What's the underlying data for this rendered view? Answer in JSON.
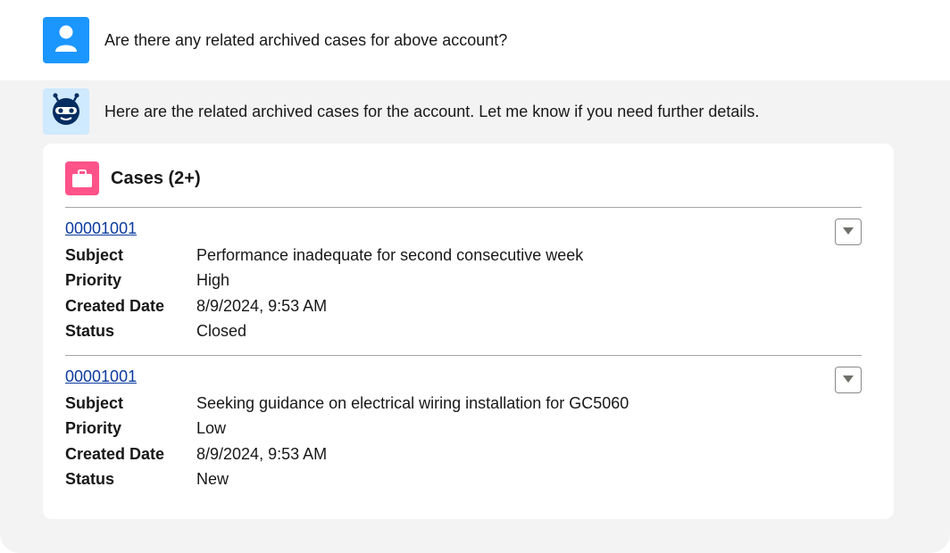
{
  "user_message": {
    "avatar_icon": "user-icon",
    "text": "Are there any related archived cases for above account?"
  },
  "bot_message": {
    "avatar_icon": "bot-icon",
    "text": "Here are the related archived cases for the account. Let me know if you need further details."
  },
  "cases_card": {
    "icon": "briefcase-icon",
    "icon_color": "#ff538a",
    "title": "Cases (2+)",
    "records": [
      {
        "case_number": "00001001",
        "fields": [
          {
            "label": "Subject",
            "value": "Performance inadequate for second consecutive week"
          },
          {
            "label": "Priority",
            "value": "High"
          },
          {
            "label": "Created Date",
            "value": "8/9/2024, 9:53 AM"
          },
          {
            "label": "Status",
            "value": "Closed"
          }
        ]
      },
      {
        "case_number": "00001001",
        "fields": [
          {
            "label": "Subject",
            "value": "Seeking guidance on electrical wiring installation for GC5060"
          },
          {
            "label": "Priority",
            "value": "Low"
          },
          {
            "label": "Created Date",
            "value": "8/9/2024, 9:53 AM"
          },
          {
            "label": "Status",
            "value": "New"
          }
        ]
      }
    ]
  },
  "colors": {
    "user_avatar": "#1b96ff",
    "bot_avatar_bg": "#cfe9fe",
    "link": "#0b3a9e",
    "panel_bg": "#f3f3f3"
  }
}
